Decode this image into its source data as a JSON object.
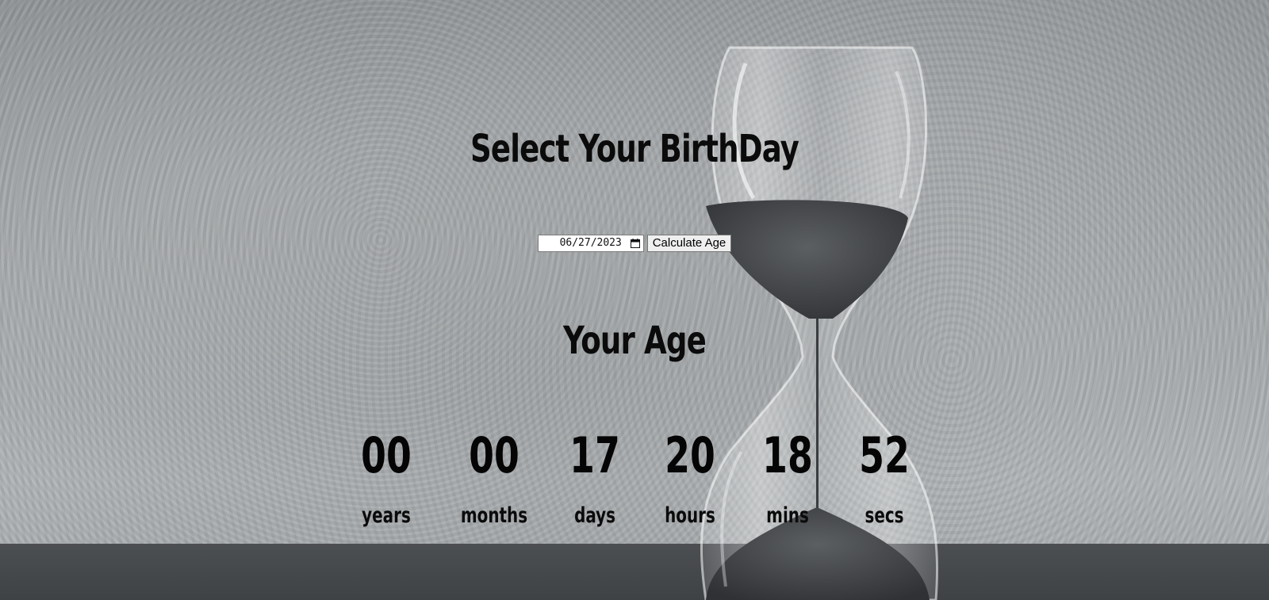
{
  "page": {
    "title": "Select Your BirthDay",
    "subtitle": "Your Age"
  },
  "form": {
    "date_value": "06/27/2023",
    "button_label": "Calculate Age"
  },
  "age": [
    {
      "value": "00",
      "unit": "years"
    },
    {
      "value": "00",
      "unit": "months"
    },
    {
      "value": "17",
      "unit": "days"
    },
    {
      "value": "20",
      "unit": "hours"
    },
    {
      "value": "18",
      "unit": "mins"
    },
    {
      "value": "52",
      "unit": "secs"
    }
  ],
  "icons": {
    "date_picker": "calendar-icon",
    "background": "hourglass-icon"
  },
  "colors": {
    "text": "#0b0b0b",
    "table": "#45484b"
  }
}
